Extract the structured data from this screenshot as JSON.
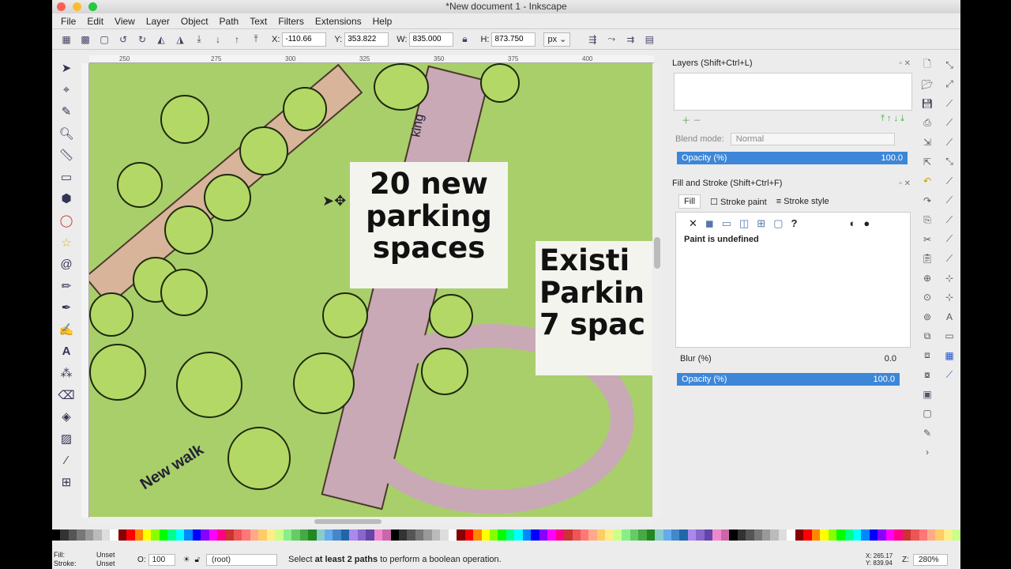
{
  "window": {
    "title": "*New document 1 - Inkscape"
  },
  "menu": [
    "File",
    "Edit",
    "View",
    "Layer",
    "Object",
    "Path",
    "Text",
    "Filters",
    "Extensions",
    "Help"
  ],
  "toolbar": {
    "x_label": "X:",
    "x": "-110.66",
    "y_label": "Y:",
    "y": "353.822",
    "w_label": "W:",
    "w": "835.000",
    "h_label": "H:",
    "h": "873.750",
    "unit": "px"
  },
  "ruler": {
    "h_ticks": [
      "250",
      "275",
      "300",
      "325",
      "350",
      "375",
      "400"
    ]
  },
  "canvas": {
    "labels": {
      "new_parking": "20 new parking spaces",
      "existing": "Existi Parkin 7 spac",
      "walk": "New walk",
      "king": "king"
    }
  },
  "layers": {
    "title": "Layers (Shift+Ctrl+L)",
    "blend_label": "Blend mode:",
    "blend": "Normal",
    "opacity_label": "Opacity (%)",
    "opacity": "100.0"
  },
  "fill_stroke": {
    "title": "Fill and Stroke (Shift+Ctrl+F)",
    "tabs": [
      "Fill",
      "Stroke paint",
      "Stroke style"
    ],
    "paint_msg": "Paint is undefined",
    "blur_label": "Blur (%)",
    "blur": "0.0",
    "opacity_label": "Opacity (%)",
    "opacity": "100.0"
  },
  "status": {
    "fill_label": "Fill:",
    "fill": "Unset",
    "stroke_label": "Stroke:",
    "stroke": "Unset",
    "o_label": "O:",
    "o": "100",
    "layer": "(root)",
    "msg_pre": "Select ",
    "msg_bold": "at least 2 paths",
    "msg_post": " to perform a boolean operation.",
    "cx": "X: 265.17",
    "cy": "Y: 839.94",
    "z_label": "Z:",
    "zoom": "280%"
  },
  "colors": {
    "accent": "#3d86d8",
    "canvas": "#a9cf6b"
  }
}
